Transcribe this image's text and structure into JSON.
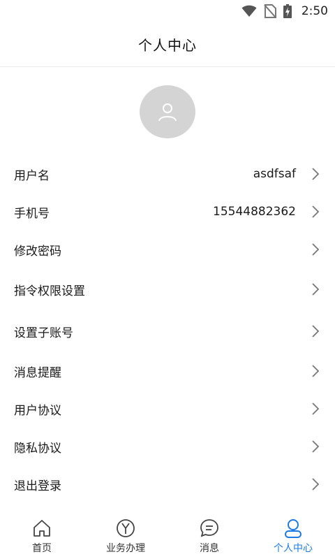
{
  "status_bar": {
    "time": "2:50",
    "icons": [
      "wifi-icon",
      "no-sim-icon",
      "battery-charging-icon"
    ]
  },
  "header": {
    "title": "个人中心"
  },
  "profile": {
    "avatar_icon": "user-icon"
  },
  "menu": {
    "items": [
      {
        "label": "用户名",
        "value": "asdfsaf"
      },
      {
        "label": "手机号",
        "value": "15544882362"
      },
      {
        "label": "修改密码",
        "value": ""
      },
      {
        "label": "指令权限设置",
        "value": ""
      },
      {
        "label": "设置子账号",
        "value": ""
      },
      {
        "label": "消息提醒",
        "value": ""
      },
      {
        "label": "用户协议",
        "value": ""
      },
      {
        "label": "隐私协议",
        "value": ""
      },
      {
        "label": "退出登录",
        "value": ""
      }
    ]
  },
  "tabbar": {
    "tabs": [
      {
        "label": "首页",
        "icon": "home-icon",
        "active": false
      },
      {
        "label": "业务办理",
        "icon": "yuan-circle-icon",
        "active": false
      },
      {
        "label": "消息",
        "icon": "message-bubble-icon",
        "active": false
      },
      {
        "label": "个人中心",
        "icon": "person-icon",
        "active": true
      }
    ]
  },
  "colors": {
    "accent": "#1d7be6",
    "avatar_bg": "#d4d4d4",
    "divider": "#ececec"
  }
}
